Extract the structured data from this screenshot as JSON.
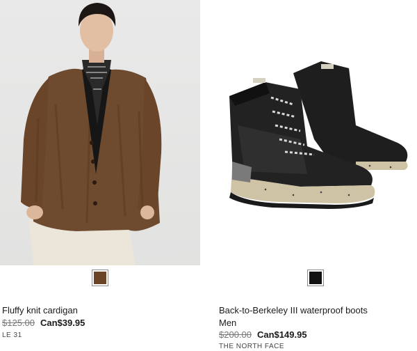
{
  "products": [
    {
      "name": "Fluffy knit cardigan",
      "old_price": "$125.00",
      "price": "Can$39.95",
      "brand": "LE 31",
      "swatch_color": "#6b4327"
    },
    {
      "name": "Back-to-Berkeley III waterproof boots",
      "subtitle": "Men",
      "old_price": "$200.00",
      "price": "Can$149.95",
      "brand": "THE NORTH FACE",
      "swatch_color": "#111111"
    }
  ]
}
